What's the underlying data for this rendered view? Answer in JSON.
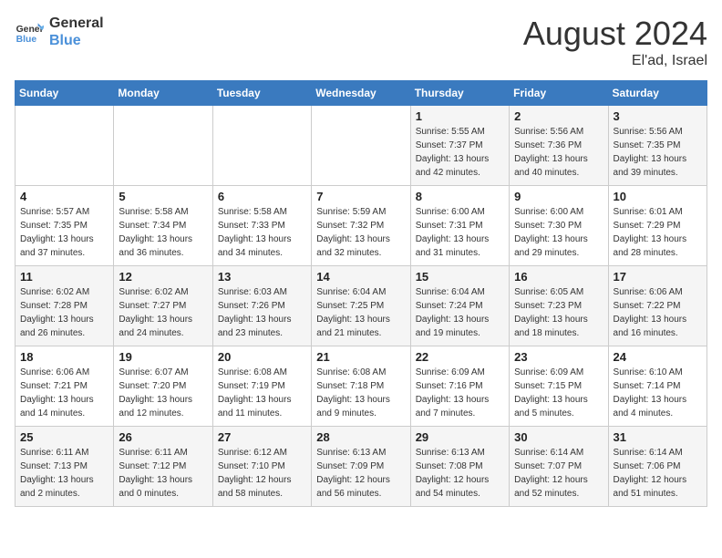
{
  "header": {
    "logo_line1": "General",
    "logo_line2": "Blue",
    "month_year": "August 2024",
    "location": "El'ad, Israel"
  },
  "weekdays": [
    "Sunday",
    "Monday",
    "Tuesday",
    "Wednesday",
    "Thursday",
    "Friday",
    "Saturday"
  ],
  "weeks": [
    [
      {
        "day": "",
        "info": ""
      },
      {
        "day": "",
        "info": ""
      },
      {
        "day": "",
        "info": ""
      },
      {
        "day": "",
        "info": ""
      },
      {
        "day": "1",
        "info": "Sunrise: 5:55 AM\nSunset: 7:37 PM\nDaylight: 13 hours\nand 42 minutes."
      },
      {
        "day": "2",
        "info": "Sunrise: 5:56 AM\nSunset: 7:36 PM\nDaylight: 13 hours\nand 40 minutes."
      },
      {
        "day": "3",
        "info": "Sunrise: 5:56 AM\nSunset: 7:35 PM\nDaylight: 13 hours\nand 39 minutes."
      }
    ],
    [
      {
        "day": "4",
        "info": "Sunrise: 5:57 AM\nSunset: 7:35 PM\nDaylight: 13 hours\nand 37 minutes."
      },
      {
        "day": "5",
        "info": "Sunrise: 5:58 AM\nSunset: 7:34 PM\nDaylight: 13 hours\nand 36 minutes."
      },
      {
        "day": "6",
        "info": "Sunrise: 5:58 AM\nSunset: 7:33 PM\nDaylight: 13 hours\nand 34 minutes."
      },
      {
        "day": "7",
        "info": "Sunrise: 5:59 AM\nSunset: 7:32 PM\nDaylight: 13 hours\nand 32 minutes."
      },
      {
        "day": "8",
        "info": "Sunrise: 6:00 AM\nSunset: 7:31 PM\nDaylight: 13 hours\nand 31 minutes."
      },
      {
        "day": "9",
        "info": "Sunrise: 6:00 AM\nSunset: 7:30 PM\nDaylight: 13 hours\nand 29 minutes."
      },
      {
        "day": "10",
        "info": "Sunrise: 6:01 AM\nSunset: 7:29 PM\nDaylight: 13 hours\nand 28 minutes."
      }
    ],
    [
      {
        "day": "11",
        "info": "Sunrise: 6:02 AM\nSunset: 7:28 PM\nDaylight: 13 hours\nand 26 minutes."
      },
      {
        "day": "12",
        "info": "Sunrise: 6:02 AM\nSunset: 7:27 PM\nDaylight: 13 hours\nand 24 minutes."
      },
      {
        "day": "13",
        "info": "Sunrise: 6:03 AM\nSunset: 7:26 PM\nDaylight: 13 hours\nand 23 minutes."
      },
      {
        "day": "14",
        "info": "Sunrise: 6:04 AM\nSunset: 7:25 PM\nDaylight: 13 hours\nand 21 minutes."
      },
      {
        "day": "15",
        "info": "Sunrise: 6:04 AM\nSunset: 7:24 PM\nDaylight: 13 hours\nand 19 minutes."
      },
      {
        "day": "16",
        "info": "Sunrise: 6:05 AM\nSunset: 7:23 PM\nDaylight: 13 hours\nand 18 minutes."
      },
      {
        "day": "17",
        "info": "Sunrise: 6:06 AM\nSunset: 7:22 PM\nDaylight: 13 hours\nand 16 minutes."
      }
    ],
    [
      {
        "day": "18",
        "info": "Sunrise: 6:06 AM\nSunset: 7:21 PM\nDaylight: 13 hours\nand 14 minutes."
      },
      {
        "day": "19",
        "info": "Sunrise: 6:07 AM\nSunset: 7:20 PM\nDaylight: 13 hours\nand 12 minutes."
      },
      {
        "day": "20",
        "info": "Sunrise: 6:08 AM\nSunset: 7:19 PM\nDaylight: 13 hours\nand 11 minutes."
      },
      {
        "day": "21",
        "info": "Sunrise: 6:08 AM\nSunset: 7:18 PM\nDaylight: 13 hours\nand 9 minutes."
      },
      {
        "day": "22",
        "info": "Sunrise: 6:09 AM\nSunset: 7:16 PM\nDaylight: 13 hours\nand 7 minutes."
      },
      {
        "day": "23",
        "info": "Sunrise: 6:09 AM\nSunset: 7:15 PM\nDaylight: 13 hours\nand 5 minutes."
      },
      {
        "day": "24",
        "info": "Sunrise: 6:10 AM\nSunset: 7:14 PM\nDaylight: 13 hours\nand 4 minutes."
      }
    ],
    [
      {
        "day": "25",
        "info": "Sunrise: 6:11 AM\nSunset: 7:13 PM\nDaylight: 13 hours\nand 2 minutes."
      },
      {
        "day": "26",
        "info": "Sunrise: 6:11 AM\nSunset: 7:12 PM\nDaylight: 13 hours\nand 0 minutes."
      },
      {
        "day": "27",
        "info": "Sunrise: 6:12 AM\nSunset: 7:10 PM\nDaylight: 12 hours\nand 58 minutes."
      },
      {
        "day": "28",
        "info": "Sunrise: 6:13 AM\nSunset: 7:09 PM\nDaylight: 12 hours\nand 56 minutes."
      },
      {
        "day": "29",
        "info": "Sunrise: 6:13 AM\nSunset: 7:08 PM\nDaylight: 12 hours\nand 54 minutes."
      },
      {
        "day": "30",
        "info": "Sunrise: 6:14 AM\nSunset: 7:07 PM\nDaylight: 12 hours\nand 52 minutes."
      },
      {
        "day": "31",
        "info": "Sunrise: 6:14 AM\nSunset: 7:06 PM\nDaylight: 12 hours\nand 51 minutes."
      }
    ]
  ]
}
